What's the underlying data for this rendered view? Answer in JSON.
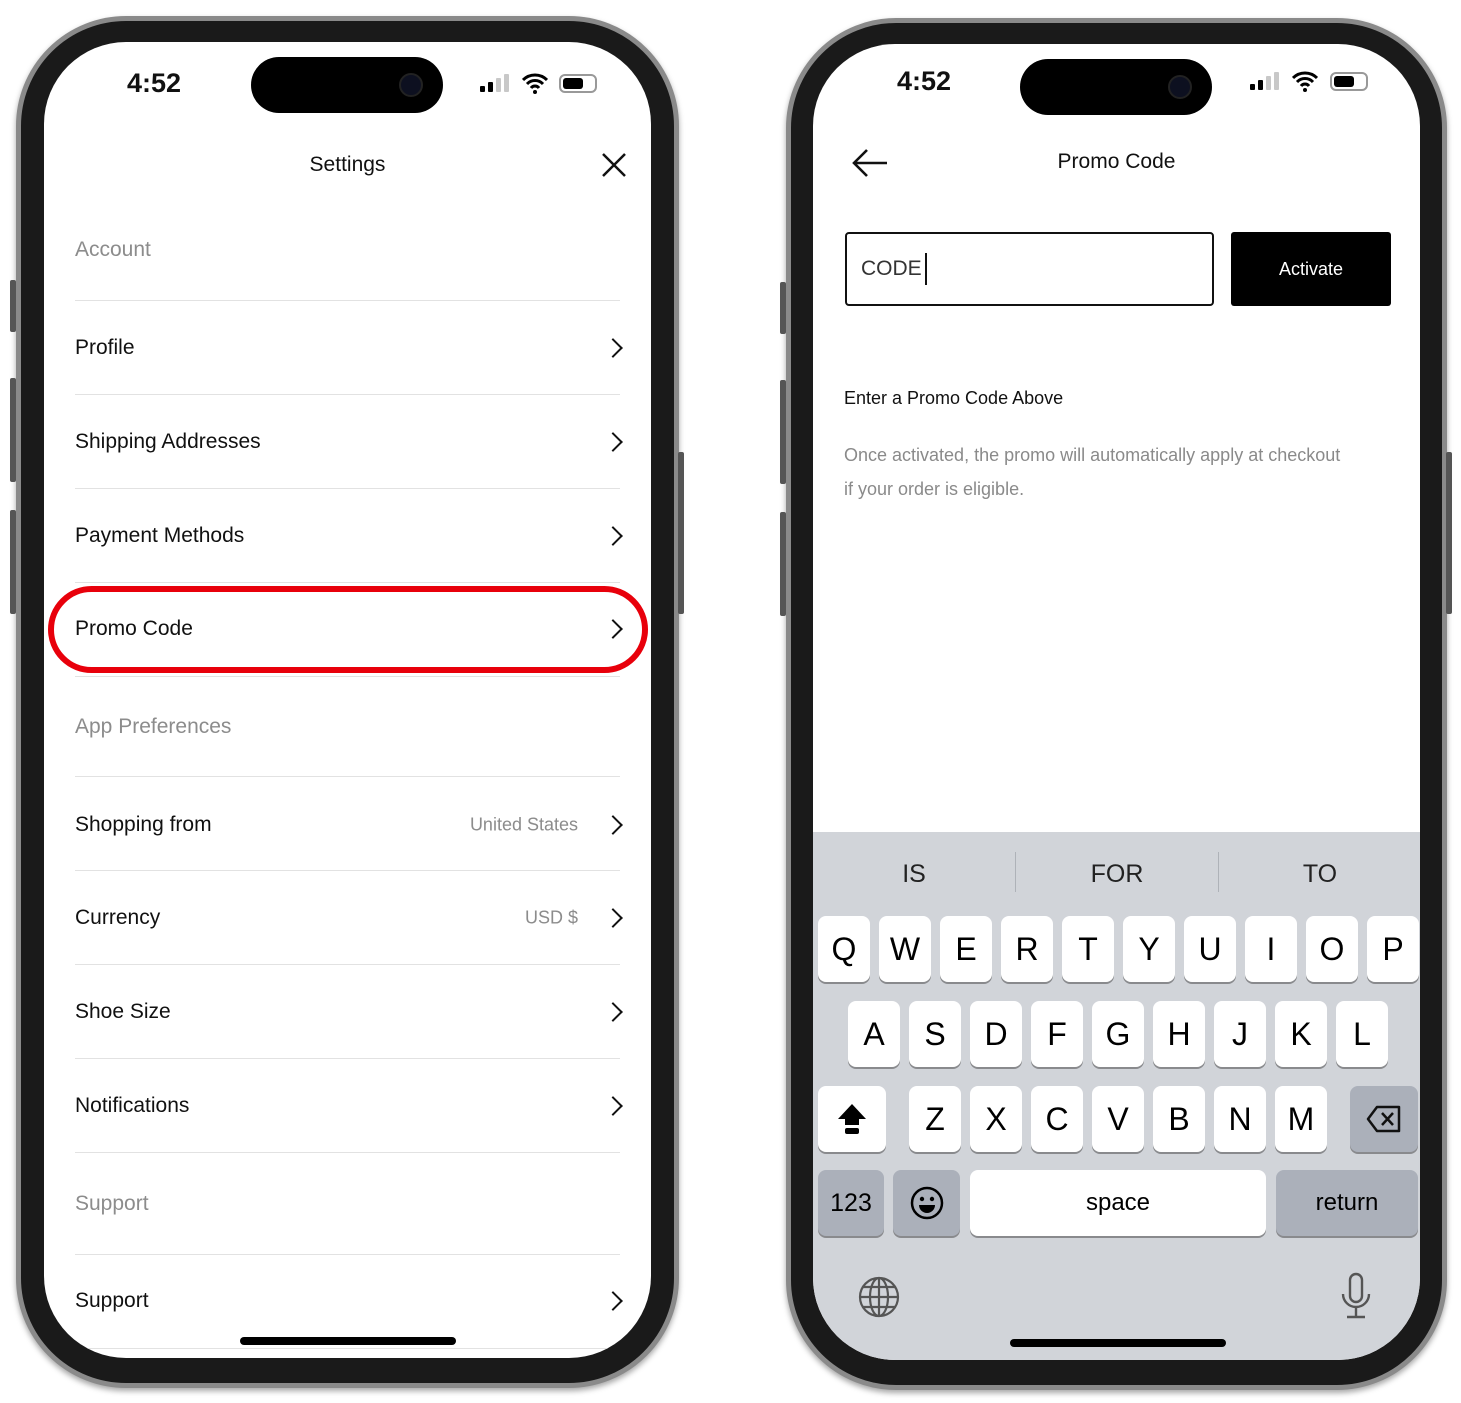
{
  "left_phone": {
    "status": {
      "time": "4:52"
    },
    "header": {
      "title": "Settings",
      "close_icon": "close-icon"
    },
    "sections": [
      {
        "label": "Account",
        "items": [
          {
            "label": "Profile",
            "value": ""
          },
          {
            "label": "Shipping Addresses",
            "value": ""
          },
          {
            "label": "Payment Methods",
            "value": ""
          },
          {
            "label": "Promo Code",
            "value": "",
            "highlighted": true
          }
        ]
      },
      {
        "label": "App Preferences",
        "items": [
          {
            "label": "Shopping from",
            "value": "United States"
          },
          {
            "label": "Currency",
            "value": "USD $"
          },
          {
            "label": "Shoe Size",
            "value": ""
          },
          {
            "label": "Notifications",
            "value": ""
          }
        ]
      },
      {
        "label": "Support",
        "items": [
          {
            "label": "Support",
            "value": ""
          }
        ]
      }
    ],
    "highlight_color": "#e8000b"
  },
  "right_phone": {
    "status": {
      "time": "4:52"
    },
    "header": {
      "title": "Promo Code",
      "back_icon": "arrow-left-icon"
    },
    "input": {
      "value": "CODE"
    },
    "activate_label": "Activate",
    "heading": "Enter a Promo Code Above",
    "description_line1": "Once activated, the promo will automatically apply at checkout",
    "description_line2": "if your order is eligible.",
    "keyboard": {
      "suggestions": [
        "IS",
        "FOR",
        "TO"
      ],
      "row1": [
        "Q",
        "W",
        "E",
        "R",
        "T",
        "Y",
        "U",
        "I",
        "O",
        "P"
      ],
      "row2": [
        "A",
        "S",
        "D",
        "F",
        "G",
        "H",
        "J",
        "K",
        "L"
      ],
      "row3": [
        "Z",
        "X",
        "C",
        "V",
        "B",
        "N",
        "M"
      ],
      "numbers_label": "123",
      "space_label": "space",
      "return_label": "return"
    }
  }
}
